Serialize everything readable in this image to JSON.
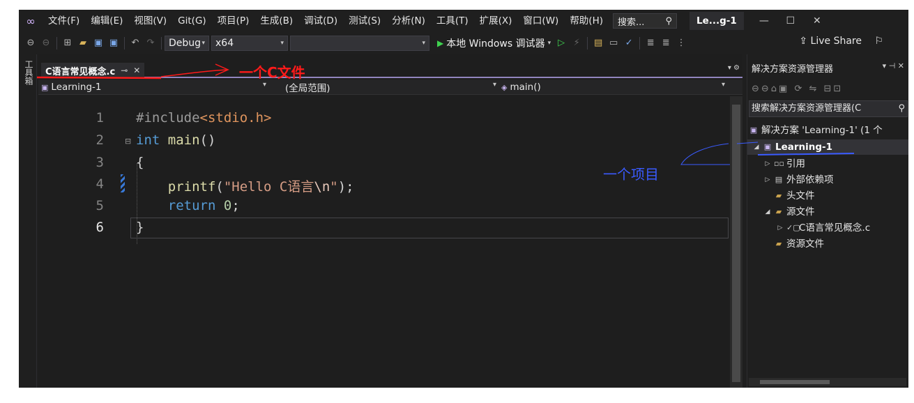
{
  "menubar": {
    "items": [
      "文件(F)",
      "编辑(E)",
      "视图(V)",
      "Git(G)",
      "项目(P)",
      "生成(B)",
      "调试(D)",
      "测试(S)",
      "分析(N)",
      "工具(T)",
      "扩展(X)",
      "窗口(W)",
      "帮助(H)"
    ],
    "search_label": "搜索...",
    "title": "Le...g-1"
  },
  "toolbar": {
    "config": "Debug",
    "platform": "x64",
    "run_label": "本地 Windows 调试器",
    "live_share": "Live Share"
  },
  "toolstrip": {
    "label": "工具箱"
  },
  "editor": {
    "tab_label": "C语言常见概念.c",
    "nav_project": "Learning-1",
    "nav_scope": "(全局范围)",
    "nav_member": "main()",
    "line_numbers": [
      "1",
      "2",
      "3",
      "4",
      "5",
      "6"
    ],
    "code": {
      "l1_pp": "#include",
      "l1_hdr": "<stdio.h>",
      "l2_kw": "int",
      "l2_fn": "main",
      "l2_rest": "()",
      "l3": "{",
      "l4_fn": "printf",
      "l4_open": "(",
      "l4_str": "\"Hello C语言",
      "l4_esc": "\\n",
      "l4_strend": "\"",
      "l4_close": ");",
      "l5_kw": "return",
      "l5_num": "0",
      "l5_semi": ";",
      "l6": "}"
    }
  },
  "solution": {
    "title": "解决方案资源管理器",
    "search_placeholder": "搜索解决方案资源管理器(C",
    "items": [
      {
        "label": "解决方案 'Learning-1' (1 个"
      },
      {
        "label": "Learning-1"
      },
      {
        "label": "引用"
      },
      {
        "label": "外部依赖项"
      },
      {
        "label": "头文件"
      },
      {
        "label": "源文件"
      },
      {
        "label": "C语言常见概念.c"
      },
      {
        "label": "资源文件"
      }
    ]
  },
  "annotations": {
    "file": "一个C文件",
    "project": "一个项目"
  },
  "colors": {
    "accent": "#9185be",
    "annotation_red": "#ff1a1a",
    "annotation_blue": "#3a5bff"
  }
}
